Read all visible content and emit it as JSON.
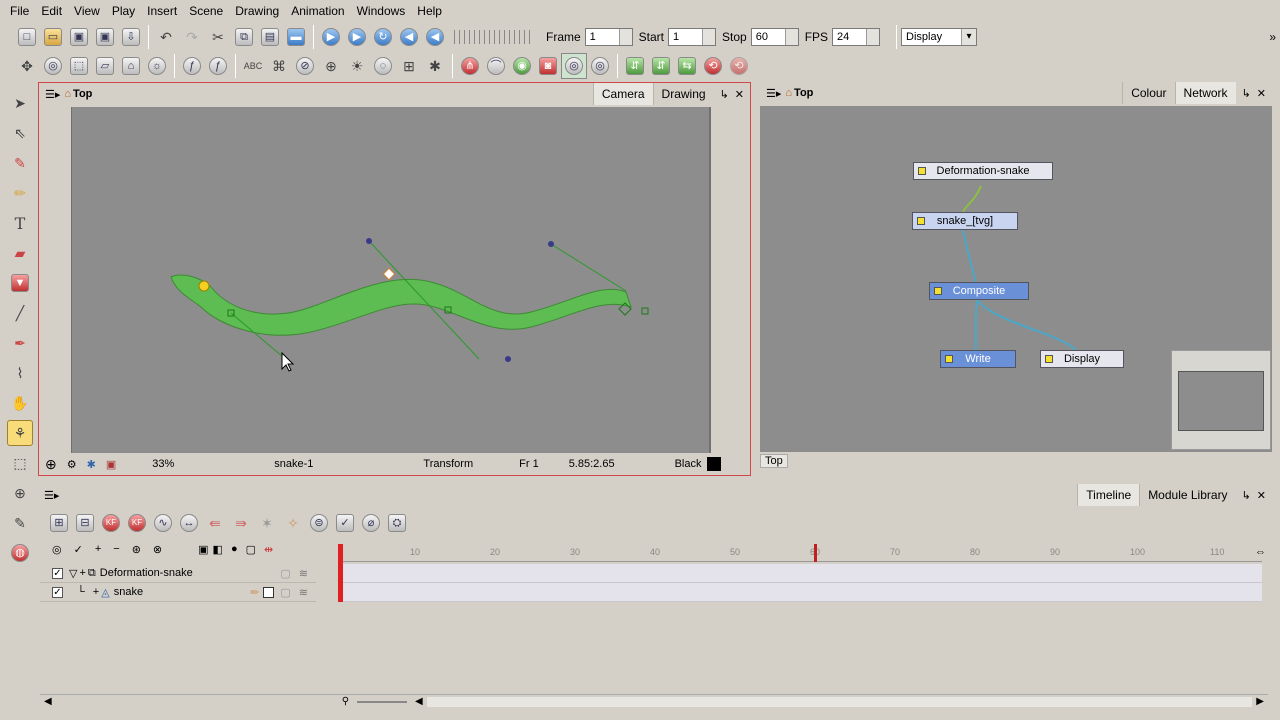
{
  "menu": [
    "File",
    "Edit",
    "View",
    "Play",
    "Insert",
    "Scene",
    "Drawing",
    "Animation",
    "Windows",
    "Help"
  ],
  "toolbar": {
    "frame_label": "Frame",
    "frame_value": "1",
    "start_label": "Start",
    "start_value": "1",
    "stop_label": "Stop",
    "stop_value": "60",
    "fps_label": "FPS",
    "fps_value": "24",
    "display_select": "Display"
  },
  "camera_view": {
    "view_title": "Top",
    "tabs": [
      "Camera",
      "Drawing"
    ],
    "zoom": "33%",
    "drawing_name": "snake-1",
    "tool_name": "Transform",
    "frame_readout": "Fr 1",
    "coord_readout": "5.85:2.65",
    "color_name": "Black",
    "color_swatch": "#000000",
    "snake_color": "#5bbf4f"
  },
  "network_view": {
    "view_title": "Top",
    "tabs": [
      "Colour",
      "Network"
    ],
    "footer_label": "Top",
    "nodes": [
      "Deformation-snake",
      "snake_[tvg]",
      "Composite",
      "Write",
      "Display"
    ]
  },
  "timeline": {
    "tabs": [
      "Timeline",
      "Module Library"
    ],
    "layers": [
      "Deformation-snake",
      "snake"
    ],
    "ruler_ticks": [
      "10",
      "20",
      "30",
      "40",
      "50",
      "60",
      "70",
      "80",
      "90",
      "100",
      "110"
    ],
    "current_frame": 1,
    "stop_frame": 60
  }
}
